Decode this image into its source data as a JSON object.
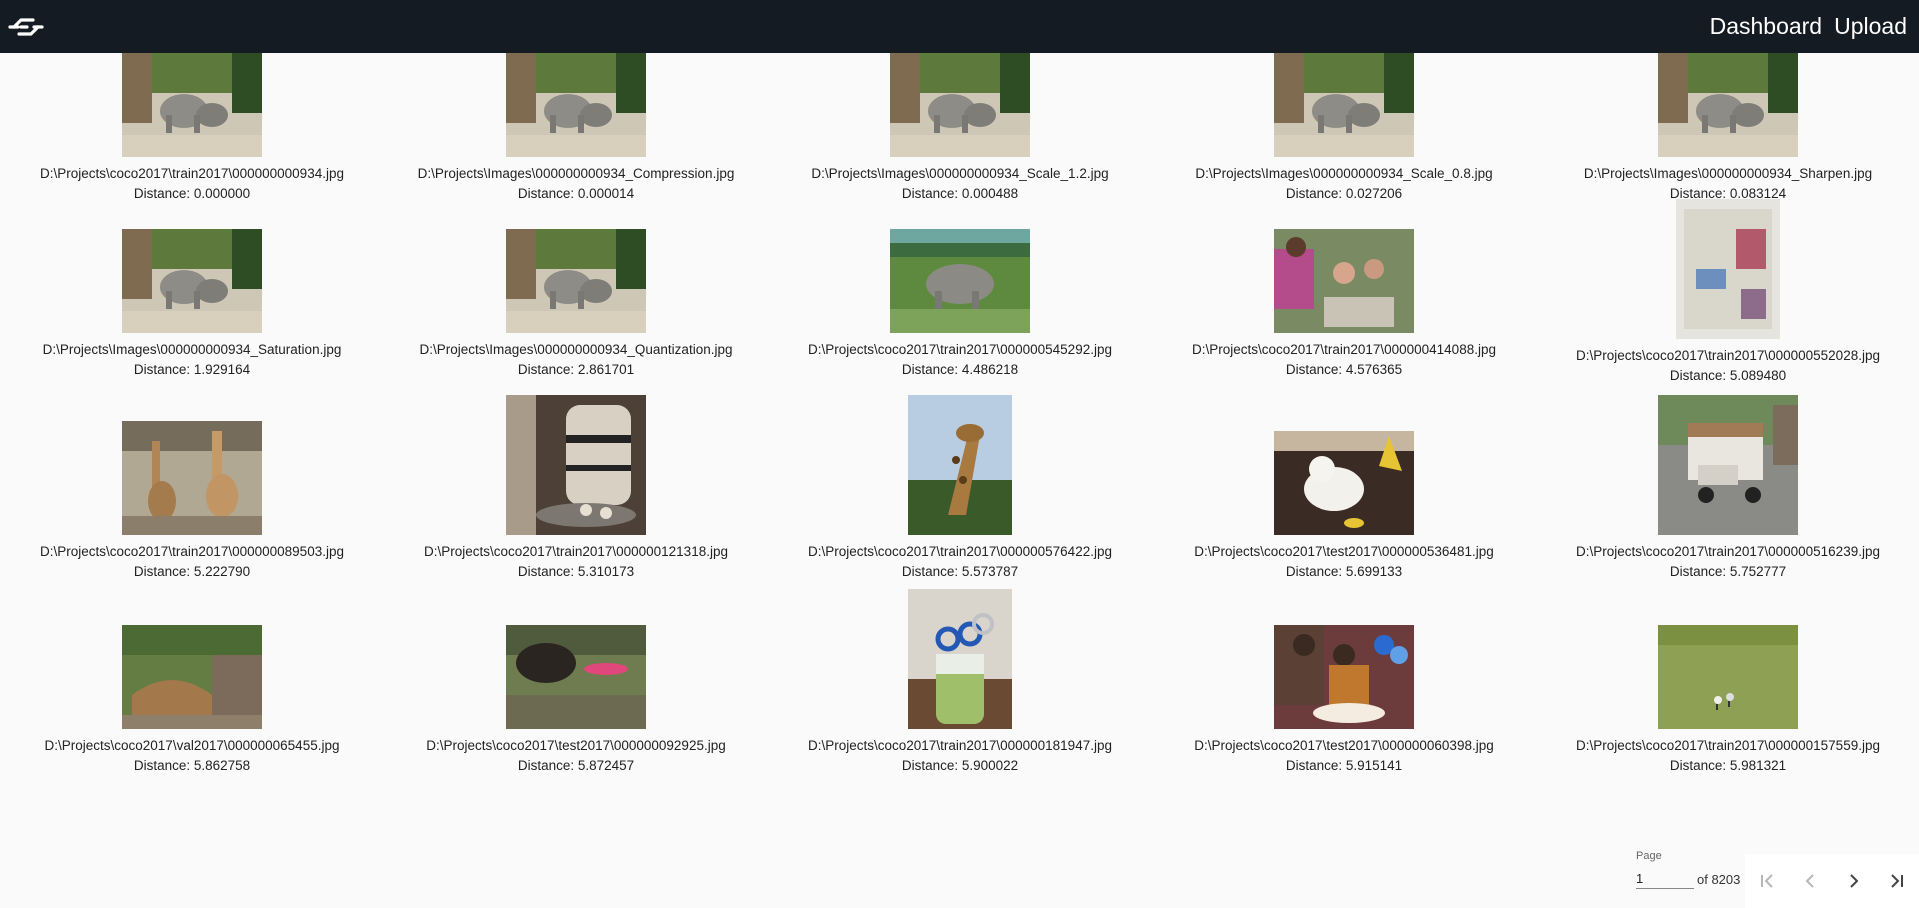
{
  "header": {
    "logo_icon": "connection-logo-icon",
    "nav": [
      "Dashboard",
      "Upload"
    ]
  },
  "results": [
    {
      "path": "D:\\Projects\\coco2017\\train2017\\000000000934.jpg",
      "distance": "Distance: 0.000000",
      "thumb": "elephants"
    },
    {
      "path": "D:\\Projects\\Images\\000000000934_Compression.jpg",
      "distance": "Distance: 0.000014",
      "thumb": "elephants"
    },
    {
      "path": "D:\\Projects\\Images\\000000000934_Scale_1.2.jpg",
      "distance": "Distance: 0.000488",
      "thumb": "elephants"
    },
    {
      "path": "D:\\Projects\\Images\\000000000934_Scale_0.8.jpg",
      "distance": "Distance: 0.027206",
      "thumb": "elephants"
    },
    {
      "path": "D:\\Projects\\Images\\000000000934_Sharpen.jpg",
      "distance": "Distance: 0.083124",
      "thumb": "elephants"
    },
    {
      "path": "D:\\Projects\\Images\\000000000934_Saturation.jpg",
      "distance": "Distance: 1.929164",
      "thumb": "elephants"
    },
    {
      "path": "D:\\Projects\\Images\\000000000934_Quantization.jpg",
      "distance": "Distance: 2.861701",
      "thumb": "elephants"
    },
    {
      "path": "D:\\Projects\\coco2017\\train2017\\000000545292.jpg",
      "distance": "Distance: 4.486218",
      "thumb": "elephant-grass"
    },
    {
      "path": "D:\\Projects\\coco2017\\train2017\\000000414088.jpg",
      "distance": "Distance: 4.576365",
      "thumb": "kids-table"
    },
    {
      "path": "D:\\Projects\\coco2017\\train2017\\000000552028.jpg",
      "distance": "Distance: 5.089480",
      "thumb": "fridge-door"
    },
    {
      "path": "D:\\Projects\\coco2017\\train2017\\000000089503.jpg",
      "distance": "Distance: 5.222790",
      "thumb": "giraffes-pen"
    },
    {
      "path": "D:\\Projects\\coco2017\\train2017\\000000121318.jpg",
      "distance": "Distance: 5.310173",
      "thumb": "pottery"
    },
    {
      "path": "D:\\Projects\\coco2017\\train2017\\000000576422.jpg",
      "distance": "Distance: 5.573787",
      "thumb": "giraffe-sky"
    },
    {
      "path": "D:\\Projects\\coco2017\\test2017\\000000536481.jpg",
      "distance": "Distance: 5.699133",
      "thumb": "white-cat"
    },
    {
      "path": "D:\\Projects\\coco2017\\train2017\\000000516239.jpg",
      "distance": "Distance: 5.752777",
      "thumb": "truck-street"
    },
    {
      "path": "D:\\Projects\\coco2017\\val2017\\000000065455.jpg",
      "distance": "Distance: 5.862758",
      "thumb": "giraffes-feeding"
    },
    {
      "path": "D:\\Projects\\coco2017\\test2017\\000000092925.jpg",
      "distance": "Distance: 5.872457",
      "thumb": "bear-field"
    },
    {
      "path": "D:\\Projects\\coco2017\\train2017\\000000181947.jpg",
      "distance": "Distance: 5.900022",
      "thumb": "scissors-cup"
    },
    {
      "path": "D:\\Projects\\coco2017\\test2017\\000000060398.jpg",
      "distance": "Distance: 5.915141",
      "thumb": "family-cake"
    },
    {
      "path": "D:\\Projects\\coco2017\\train2017\\000000157559.jpg",
      "distance": "Distance: 5.981321",
      "thumb": "sheep-hill"
    }
  ],
  "pagination": {
    "page_label": "Page",
    "page_value": "1",
    "of_label": "of 8203",
    "first_icon": "first-page-icon",
    "prev_icon": "chevron-left-icon",
    "next_icon": "chevron-right-icon",
    "last_icon": "last-page-icon"
  }
}
